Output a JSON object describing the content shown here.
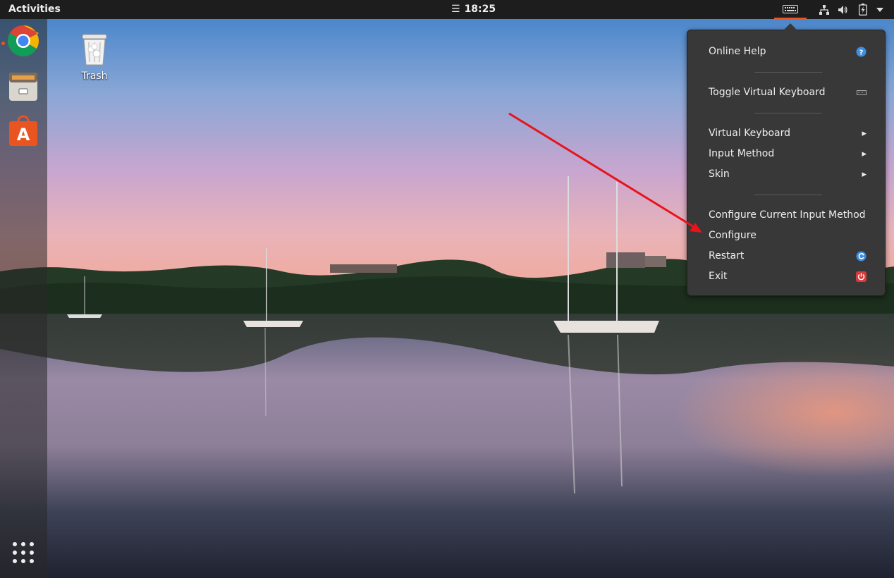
{
  "topbar": {
    "activities": "Activities",
    "clock_icon": "☰",
    "clock": "18:25",
    "tray_icons": [
      "keyboard-icon",
      "network-icon",
      "volume-icon",
      "battery-icon",
      "chevron-down-icon"
    ]
  },
  "dock": {
    "items": [
      "chrome-icon",
      "files-icon",
      "software-icon"
    ],
    "show_apps": "app-grid-icon"
  },
  "desktop": {
    "trash_label": "Trash"
  },
  "menu": {
    "online_help": "Online Help",
    "toggle_virtual_keyboard": "Toggle Virtual Keyboard",
    "virtual_keyboard": "Virtual Keyboard",
    "input_method": "Input Method",
    "skin": "Skin",
    "configure_current": "Configure Current Input Method",
    "configure": "Configure",
    "restart": "Restart",
    "exit": "Exit",
    "submenu_glyph": "▸"
  },
  "colors": {
    "accent": "#e95420",
    "annotation_arrow": "#e8131b",
    "menu_bg": "#383838"
  }
}
